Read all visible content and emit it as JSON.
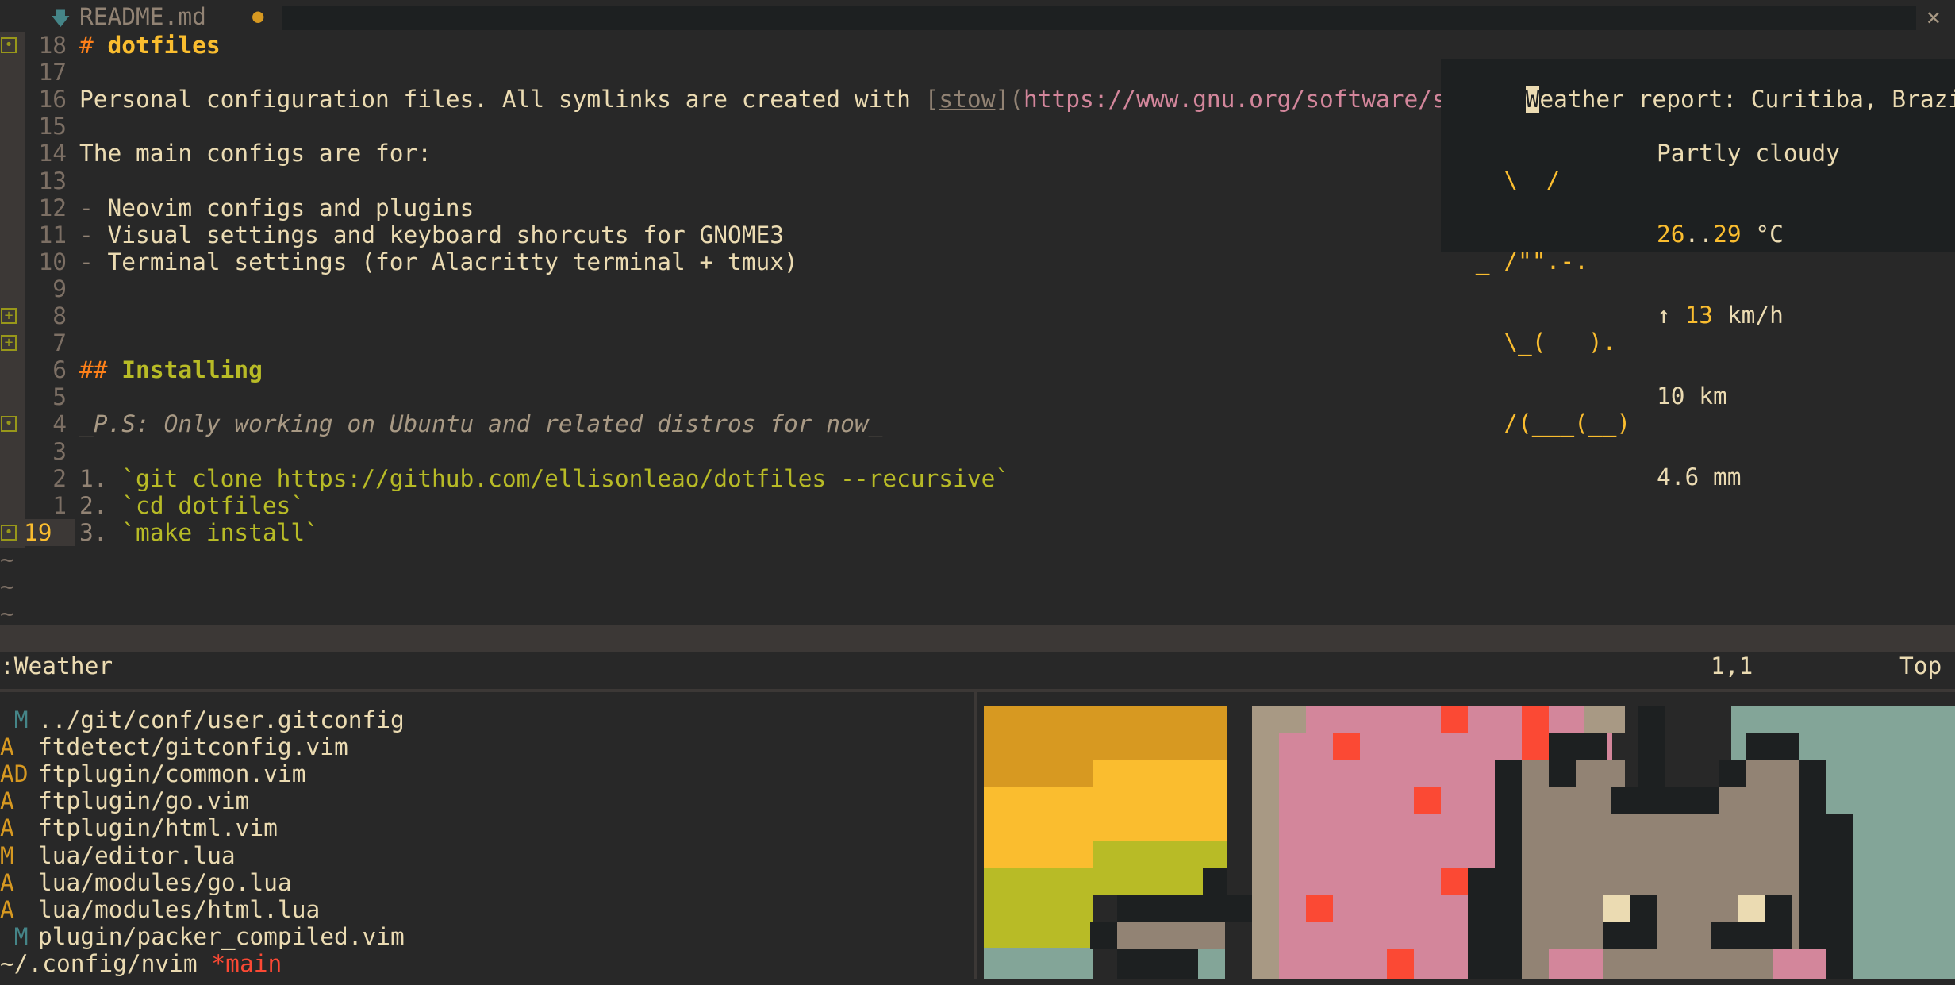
{
  "tab": {
    "filename": "README.md",
    "modified_dot": "●",
    "close_glyph": "✕"
  },
  "editor": {
    "lines": [
      {
        "num": "18",
        "segments": [
          {
            "t": "# ",
            "c": "#fe8019"
          },
          {
            "t": "dotfiles",
            "c": "#fabd2f",
            "b": true
          }
        ]
      },
      {
        "num": "17",
        "segments": []
      },
      {
        "num": "16",
        "segments": [
          {
            "t": "Personal configuration files. All symlinks are created with ",
            "c": "#ebdbb2"
          },
          {
            "t": "[",
            "c": "#928374"
          },
          {
            "t": "stow",
            "c": "#928374",
            "u": true
          },
          {
            "t": "](",
            "c": "#928374"
          },
          {
            "t": "https://www.gnu.org/software/stow/",
            "c": "#d3869b"
          },
          {
            "t": ")",
            "c": "#928374"
          }
        ]
      },
      {
        "num": "15",
        "segments": []
      },
      {
        "num": "14",
        "segments": [
          {
            "t": "The main configs are for:",
            "c": "#ebdbb2"
          }
        ]
      },
      {
        "num": "13",
        "segments": []
      },
      {
        "num": "12",
        "segments": [
          {
            "t": "- ",
            "c": "#928374"
          },
          {
            "t": "Neovim configs and plugins",
            "c": "#ebdbb2"
          }
        ]
      },
      {
        "num": "11",
        "segments": [
          {
            "t": "- ",
            "c": "#928374"
          },
          {
            "t": "Visual settings and keyboard shorcuts for GNOME3",
            "c": "#ebdbb2"
          }
        ]
      },
      {
        "num": "10",
        "segments": [
          {
            "t": "- ",
            "c": "#928374"
          },
          {
            "t": "Terminal settings (for Alacritty terminal + tmux)",
            "c": "#ebdbb2"
          }
        ]
      },
      {
        "num": "9",
        "segments": []
      },
      {
        "num": "8",
        "segments": []
      },
      {
        "num": "7",
        "segments": []
      },
      {
        "num": "6",
        "segments": [
          {
            "t": "## ",
            "c": "#fe8019"
          },
          {
            "t": "Installing",
            "c": "#b8bb26",
            "b": true
          }
        ]
      },
      {
        "num": "5",
        "segments": []
      },
      {
        "num": "4",
        "segments": [
          {
            "t": "_P.S: Only working on Ubuntu and related distros for now_",
            "c": "#a89984",
            "i": true
          }
        ]
      },
      {
        "num": "3",
        "segments": []
      },
      {
        "num": "2",
        "segments": [
          {
            "t": "1. ",
            "c": "#928374"
          },
          {
            "t": "`git clone https://github.com/ellisonleao/dotfiles --recursive`",
            "c": "#b8bb26"
          }
        ]
      },
      {
        "num": "1",
        "segments": [
          {
            "t": "2. ",
            "c": "#928374"
          },
          {
            "t": "`cd dotfiles`",
            "c": "#b8bb26"
          }
        ]
      },
      {
        "num": "19",
        "current": true,
        "segments": [
          {
            "t": "3. ",
            "c": "#928374"
          },
          {
            "t": "`make install`",
            "c": "#b8bb26"
          }
        ]
      }
    ],
    "signs": [
      {
        "row": 0,
        "glyph": "•"
      },
      {
        "row": 10,
        "glyph": "+"
      },
      {
        "row": 11,
        "glyph": "+"
      },
      {
        "row": 14,
        "glyph": "•"
      },
      {
        "row": 18,
        "glyph": "•"
      }
    ],
    "tilde": "~"
  },
  "weather": {
    "title": "Weather report: Curitiba, Brazil",
    "art": [
      "   \\  /",
      " _ /\"\".-.",
      "   \\_(   ).",
      "   /(___(__)"
    ],
    "condition": "Partly cloudy",
    "temp_low": "26",
    "temp_sep": "..",
    "temp_high": "29",
    "temp_unit": " °C",
    "wind_arrow": "↑ ",
    "wind_speed": "13",
    "wind_unit": " km/h",
    "visibility": "10 km",
    "precipitation": "4.6 mm"
  },
  "cmdline": {
    "command": ":Weather",
    "position": "1,1",
    "scroll": "Top"
  },
  "git_files": [
    {
      "status": " M",
      "status_color": "#458588",
      "path": "../git/conf/user.gitconfig"
    },
    {
      "status": "A",
      "status_color": "#d79921",
      "path": "ftdetect/gitconfig.vim"
    },
    {
      "status": "AD",
      "status_color": "#d79921",
      "path": "ftplugin/common.vim"
    },
    {
      "status": "A",
      "status_color": "#d79921",
      "path": "ftplugin/go.vim"
    },
    {
      "status": "A",
      "status_color": "#d79921",
      "path": "ftplugin/html.vim"
    },
    {
      "status": "M",
      "status_color": "#d79921",
      "path": "lua/editor.lua"
    },
    {
      "status": "A",
      "status_color": "#d79921",
      "path": "lua/modules/go.lua"
    },
    {
      "status": "A",
      "status_color": "#d79921",
      "path": "lua/modules/html.lua"
    },
    {
      "status": " M",
      "status_color": "#458588",
      "path": "plugin/packer_compiled.vim"
    }
  ],
  "prompt": {
    "dir": "~/.config/nvim",
    "branch": "*main"
  },
  "colors": {
    "bg": "#282828",
    "fg": "#ebdbb2",
    "accent": "#fabd2f",
    "orange": "#fe8019",
    "green": "#b8bb26",
    "pink": "#d3869b",
    "sign_green": "#98971a"
  },
  "icons": {
    "file": "markdown-file-icon",
    "modified": "modified-dot-icon",
    "close": "close-icon"
  }
}
